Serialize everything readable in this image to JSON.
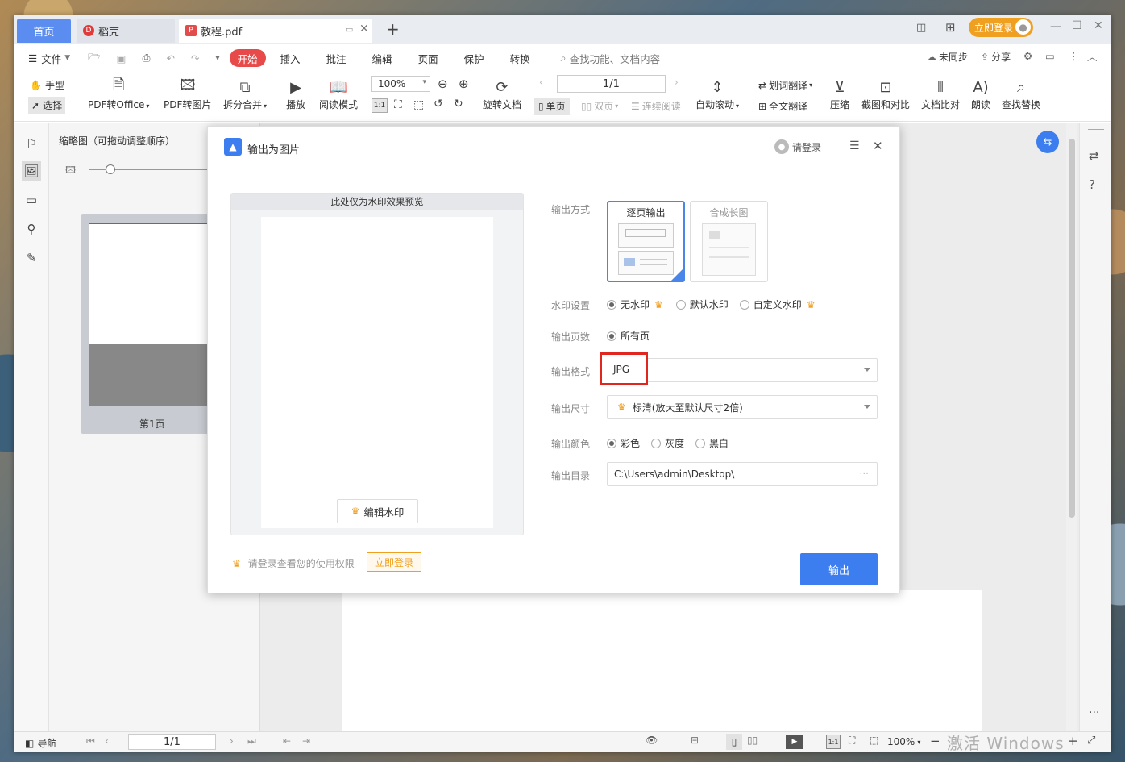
{
  "tabs": {
    "home": "首页",
    "daoke": "稻壳",
    "doc": "教程.pdf",
    "new_tab": "+"
  },
  "window_controls": {
    "login": "立即登录"
  },
  "menu": {
    "file": "文件",
    "items": [
      "开始",
      "插入",
      "批注",
      "编辑",
      "页面",
      "保护",
      "转换"
    ],
    "search_placeholder": "查找功能、文档内容",
    "sync": "未同步",
    "share": "分享"
  },
  "toolbar": {
    "hand": "手型",
    "select": "选择",
    "pdf_to_office": "PDF转Office",
    "pdf_to_image": "PDF转图片",
    "split_merge": "拆分合并",
    "play": "播放",
    "read_mode": "阅读模式",
    "zoom": "100%",
    "rotate": "旋转文档",
    "page_value": "1/1",
    "single": "单页",
    "double": "双页",
    "continuous": "连续阅读",
    "auto_scroll": "自动滚动",
    "word_translate": "划词翻译",
    "full_translate": "全文翻译",
    "compress": "压缩",
    "screenshot_compare": "截图和对比",
    "doc_compare": "文档比对",
    "read_aloud": "朗读",
    "find_replace": "查找替换"
  },
  "thumb_panel": {
    "title": "缩略图（可拖动调整顺序）",
    "page_label": "第1页"
  },
  "dialog": {
    "title": "输出为图片",
    "login": "请登录",
    "preview_header": "此处仅为水印效果预览",
    "edit_watermark": "编辑水印",
    "output_mode_label": "输出方式",
    "mode_per_page": "逐页输出",
    "mode_long": "合成长图",
    "watermark_label": "水印设置",
    "wm_none": "无水印",
    "wm_default": "默认水印",
    "wm_custom": "自定义水印",
    "pages_label": "输出页数",
    "pages_all": "所有页",
    "format_label": "输出格式",
    "format_value": "JPG",
    "size_label": "输出尺寸",
    "size_value": "标清(放大至默认尺寸2倍)",
    "color_label": "输出颜色",
    "color_full": "彩色",
    "color_gray": "灰度",
    "color_bw": "黑白",
    "dir_label": "输出目录",
    "dir_value": "C:\\Users\\admin\\Desktop\\",
    "dir_more": "···",
    "footer_hint": "请登录查看您的使用权限",
    "footer_login": "立即登录",
    "output_button": "输出"
  },
  "statusbar": {
    "nav": "导航",
    "page": "1/1",
    "zoom": "100%",
    "watermark_text": "激活 Windows"
  },
  "colors": {
    "accent": "#3c7ef0",
    "start_red": "#e84a4a",
    "login_orange": "#f0a020",
    "highlight_red": "#e0261f"
  }
}
